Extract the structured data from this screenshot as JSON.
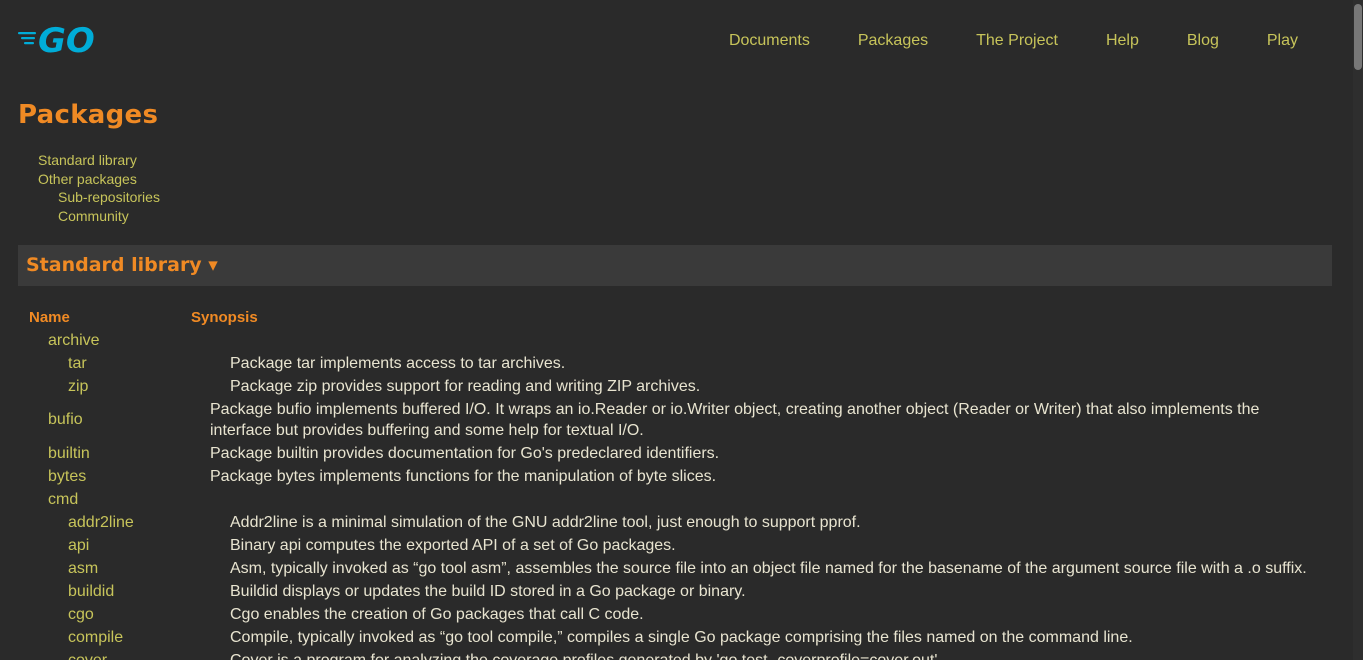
{
  "header": {
    "logo_text": "GO",
    "nav": [
      {
        "label": "Documents"
      },
      {
        "label": "Packages"
      },
      {
        "label": "The Project"
      },
      {
        "label": "Help"
      },
      {
        "label": "Blog"
      },
      {
        "label": "Play"
      }
    ]
  },
  "page_title": "Packages",
  "toc": {
    "standard": "Standard library",
    "other": "Other packages",
    "subrepos": "Sub-repositories",
    "community": "Community"
  },
  "section": {
    "title": "Standard library ▾"
  },
  "table": {
    "col_name": "Name",
    "col_synopsis": "Synopsis",
    "rows": [
      {
        "name": "archive",
        "synopsis": ""
      },
      {
        "name": "tar",
        "synopsis": "Package tar implements access to tar archives."
      },
      {
        "name": "zip",
        "synopsis": "Package zip provides support for reading and writing ZIP archives."
      },
      {
        "name": "bufio",
        "synopsis": "Package bufio implements buffered I/O. It wraps an io.Reader or io.Writer object, creating another object (Reader or Writer) that also implements the interface but provides buffering and some help for textual I/O."
      },
      {
        "name": "builtin",
        "synopsis": "Package builtin provides documentation for Go's predeclared identifiers."
      },
      {
        "name": "bytes",
        "synopsis": "Package bytes implements functions for the manipulation of byte slices."
      },
      {
        "name": "cmd",
        "synopsis": ""
      },
      {
        "name": "addr2line",
        "synopsis": "Addr2line is a minimal simulation of the GNU addr2line tool, just enough to support pprof."
      },
      {
        "name": "api",
        "synopsis": "Binary api computes the exported API of a set of Go packages."
      },
      {
        "name": "asm",
        "synopsis": "Asm, typically invoked as “go tool asm”, assembles the source file into an object file named for the basename of the argument source file with a .o suffix."
      },
      {
        "name": "buildid",
        "synopsis": "Buildid displays or updates the build ID stored in a Go package or binary."
      },
      {
        "name": "cgo",
        "synopsis": "Cgo enables the creation of Go packages that call C code."
      },
      {
        "name": "compile",
        "synopsis": "Compile, typically invoked as “go tool compile,” compiles a single Go package comprising the files named on the command line."
      },
      {
        "name": "cover",
        "synopsis": "Cover is a program for analyzing the coverage profiles generated by 'go test -coverprofile=cover.out'."
      }
    ]
  },
  "colors": {
    "background": "#2a2a2a",
    "accent_orange": "#f08a24",
    "link_yellow": "#c7c45a",
    "logo_blue": "#00acd7"
  }
}
